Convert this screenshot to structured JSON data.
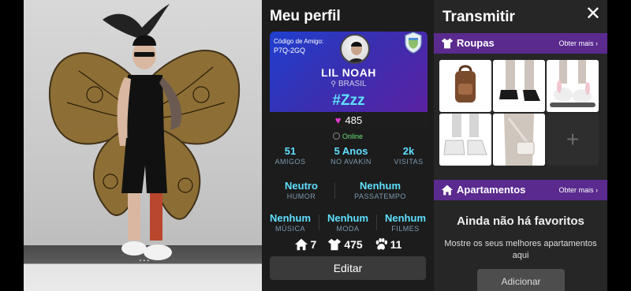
{
  "profile": {
    "title": "Meu perfil",
    "friend_code_label": "Código de Amigo:",
    "friend_code": "P7Q-2GQ",
    "name": "LIL NOAH",
    "country": "BRASIL",
    "status_text": "#Zzz",
    "loves": "485",
    "online": "Online",
    "stats_row1": [
      {
        "value": "51",
        "label": "AMIGOS"
      },
      {
        "value": "5 Anos",
        "label": "NO AVAKIN"
      },
      {
        "value": "2k",
        "label": "VISITAS"
      }
    ],
    "mood": {
      "value": "Neutro",
      "label": "HUMOR"
    },
    "hobby": {
      "value": "Nenhum",
      "label": "PASSATEMPO"
    },
    "stats_row3": [
      {
        "value": "Nenhum",
        "label": "MÚSICA"
      },
      {
        "value": "Nenhum",
        "label": "MODA"
      },
      {
        "value": "Nenhum",
        "label": "FILMES"
      }
    ],
    "counts": {
      "homes": "7",
      "outfits": "475",
      "pets": "11"
    },
    "edit_label": "Editar"
  },
  "transmit": {
    "title": "Transmitir",
    "close_icon": "close-icon",
    "outfits_label": "Roupas",
    "outfits_more": "Obter mais",
    "apartments_label": "Apartamentos",
    "apartments_more": "Obter mais",
    "empty_title": "Ainda não há favoritos",
    "empty_sub": "Mostre os seus melhores apartamentos aqui",
    "add_label": "Adicionar",
    "add_tile_symbol": "+"
  },
  "viewport": {
    "menu_dots": "..."
  },
  "colors": {
    "accent_cyan": "#5fe0ff",
    "section_purple": "#5a2a8f",
    "online_green": "#69e07a",
    "heart_pink": "#e23bd0"
  }
}
